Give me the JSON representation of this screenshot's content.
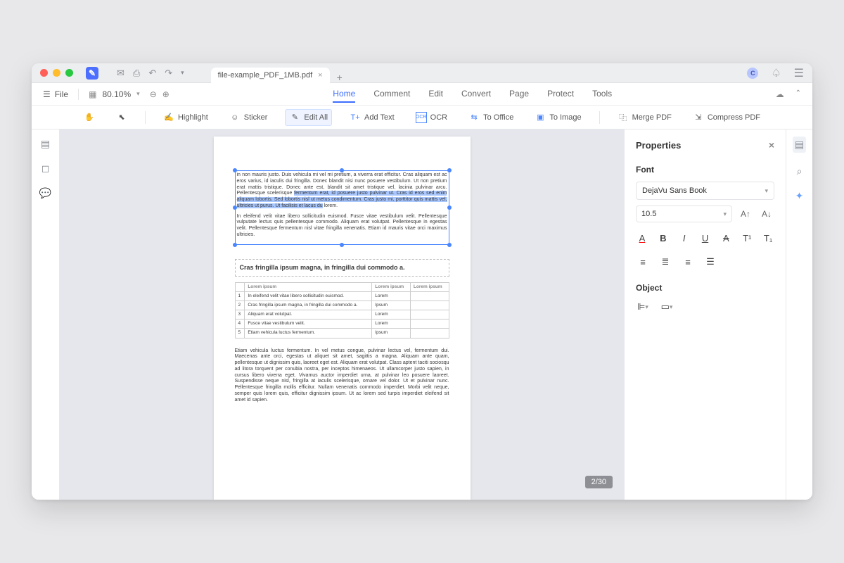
{
  "titlebar": {
    "tab_name": "file-example_PDF_1MB.pdf",
    "avatar_letter": "C"
  },
  "navbar": {
    "file_label": "File",
    "zoom": "80.10%",
    "items": [
      "Home",
      "Comment",
      "Edit",
      "Convert",
      "Page",
      "Protect",
      "Tools"
    ],
    "active_index": 0
  },
  "toolbar": {
    "highlight": "Highlight",
    "sticker": "Sticker",
    "edit_all": "Edit All",
    "add_text": "Add Text",
    "ocr": "OCR",
    "to_office": "To Office",
    "to_image": "To Image",
    "merge": "Merge PDF",
    "compress": "Compress PDF"
  },
  "doc": {
    "para1_pre": "in non mauris justo. Duis vehicula mi vel mi pretium, a viverra erat efficitur. Cras aliquam est ac eros varius, id iaculis dui fringilla. Donec blandit nisi nunc posuere vestibulum. Ut non pretium erat mattis tristique. Donec ante est, blandit sit amet tristique vel, lacinia pulvinar arcu. Pellentesque scelerisque ",
    "para1_hi": "fermentum erat, id posuere justo pulvinar ut. Cras id eros sed enim aliquam lobortis. Sed lobortis nisl ut metus condimentum. Cras justo mi, porttitor quis mattis vel, ultricies ut purus. Ut facilisis et lacus du",
    "para1_post": " lorem.",
    "para2": "In eleifend velit vitae libero sollicitudin euismod. Fusce vitae vestibulum velit. Pellentesque vulputate lectus quis pellentesque commodo. Aliquam erat volutpat. Pellentesque in egestas velit. Pellentesque fermentum nisl vitae fringilla venenatis. Etiam id mauris vitae orci maximus ultricies.",
    "heading": "Cras fringilla ipsum magna, in fringilla dui commodo a.",
    "table": {
      "headers": [
        "",
        "Lorem ipsum",
        "Lorem ipsum",
        "Lorem ipsum"
      ],
      "rows": [
        [
          "1",
          "In eleifend velit vitae libero sollicitudin euismod.",
          "Lorem",
          ""
        ],
        [
          "2",
          "Cras fringilla ipsum magna, in fringilla dui commodo a.",
          "Ipsum",
          ""
        ],
        [
          "3",
          "Aliquam erat volutpat.",
          "Lorem",
          ""
        ],
        [
          "4",
          "Fusce vitae vestibulum velit.",
          "Lorem",
          ""
        ],
        [
          "5",
          "Etiam vehicula luctus fermentum.",
          "Ipsum",
          ""
        ]
      ]
    },
    "para3": "Etiam vehicula luctus fermentum. In vel metus congue, pulvinar lectus vel, fermentum dui. Maecenas ante orci, egestas ut aliquet sit amet, sagittis a magna. Aliquam ante quam, pellentesque ut dignissim quis, laoreet eget est. Aliquam erat volutpat. Class aptent taciti sociosqu ad litora torquent per conubia nostra, per inceptos himenaeos. Ut ullamcorper justo sapien, in cursus libero viverra eget. Vivamus auctor imperdiet urna, at pulvinar leo posuere laoreet. Suspendisse neque nisl, fringilla at iaculis scelerisque, ornare vel dolor. Ut et pulvinar nunc. Pellentesque fringilla mollis efficitur. Nullam venenatis commodo imperdiet. Morbi velit neque, semper quis lorem quis, efficitur dignissim ipsum. Ut ac lorem sed turpis imperdiet eleifend sit amet id sapien.",
    "page_indicator": "2/30"
  },
  "panel": {
    "title": "Properties",
    "font_section": "Font",
    "font_family": "DejaVu Sans Book",
    "font_size": "10.5",
    "object_section": "Object"
  }
}
